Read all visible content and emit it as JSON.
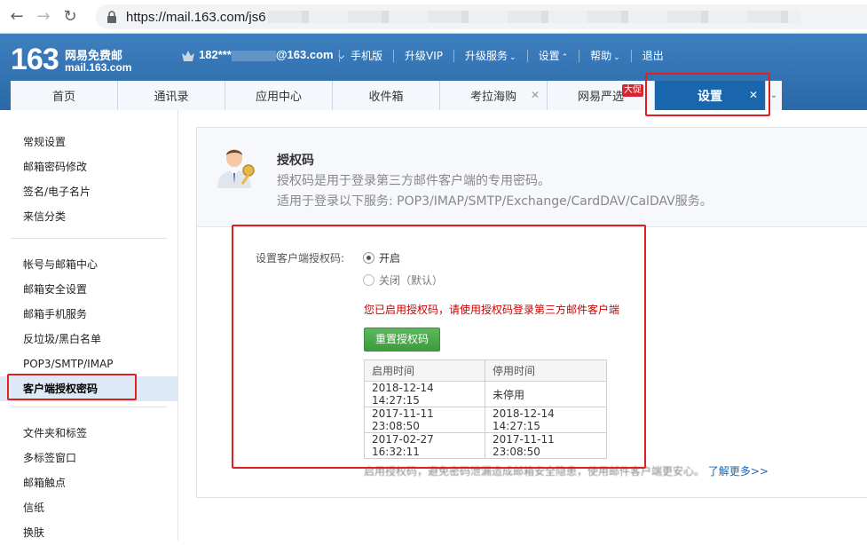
{
  "browser": {
    "url_visible": "https://mail.163.com/js6"
  },
  "header": {
    "logo_number": "163",
    "logo_cn": "网易免费邮",
    "logo_domain": "mail.163.com",
    "account_prefix": "182***",
    "account_suffix": "@163.com",
    "nav": [
      "手机版",
      "升级VIP",
      "升级服务",
      "设置",
      "帮助",
      "退出"
    ]
  },
  "tabs": [
    {
      "label": "首页"
    },
    {
      "label": "通讯录"
    },
    {
      "label": "应用中心"
    },
    {
      "label": "收件箱"
    },
    {
      "label": "考拉海购"
    },
    {
      "label": "网易严选",
      "badge": "大促"
    },
    {
      "label": "设置",
      "active": true
    }
  ],
  "sidebar": {
    "group1": [
      "常规设置",
      "邮箱密码修改",
      "签名/电子名片",
      "来信分类"
    ],
    "group2": [
      "帐号与邮箱中心",
      "邮箱安全设置",
      "邮箱手机服务",
      "反垃圾/黑白名单",
      "POP3/SMTP/IMAP",
      "客户端授权密码"
    ],
    "group3": [
      "文件夹和标签",
      "多标签窗口",
      "邮箱触点",
      "信纸",
      "换肤"
    ]
  },
  "content": {
    "title": "授权码",
    "desc1": "授权码是用于登录第三方邮件客户端的专用密码。",
    "desc2": "适用于登录以下服务: POP3/IMAP/SMTP/Exchange/CardDAV/CalDAV服务。",
    "form_label": "设置客户端授权码:",
    "option_on": "开启",
    "option_off": "关闭（默认）",
    "notice": "您已启用授权码，请使用授权码登录第三方邮件客户端",
    "reset_button": "重置授权码",
    "table": {
      "headers": [
        "启用时间",
        "停用时间"
      ],
      "rows": [
        [
          "2018-12-14 14:27:15",
          "未停用"
        ],
        [
          "2017-11-11 23:08:50",
          "2018-12-14 14:27:15"
        ],
        [
          "2017-02-27 16:32:11",
          "2017-11-11 23:08:50"
        ]
      ]
    },
    "footnote": "启用授权码，避免密码泄漏造成邮箱安全隐患，使用邮件客户端更安心。",
    "learn_more": "了解更多>>"
  }
}
